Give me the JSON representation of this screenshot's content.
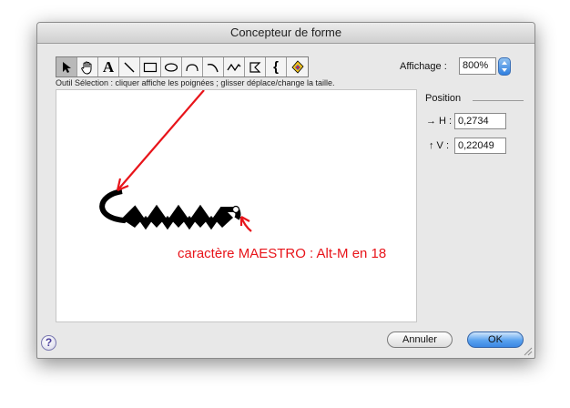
{
  "window": {
    "title": "Concepteur de forme"
  },
  "toolbar": {
    "tools": [
      {
        "icon": "arrow-select-icon",
        "selected": true
      },
      {
        "icon": "hand-icon"
      },
      {
        "icon": "text-a-icon",
        "glyph": "A"
      },
      {
        "icon": "line-icon"
      },
      {
        "icon": "rectangle-icon"
      },
      {
        "icon": "ellipse-icon"
      },
      {
        "icon": "arc-icon"
      },
      {
        "icon": "curve-icon"
      },
      {
        "icon": "wave-icon"
      },
      {
        "icon": "polygon-icon"
      },
      {
        "icon": "brace-icon",
        "glyph": "{"
      },
      {
        "icon": "fill-color-icon"
      }
    ],
    "hint": "Outil Sélection : cliquer affiche les poignées ; glisser déplace/change la taille."
  },
  "zoom": {
    "label": "Affichage :",
    "value": "800%"
  },
  "position": {
    "title": "Position",
    "h_label": "→ H :",
    "h_value": "0,2734",
    "v_label": "↑ V :",
    "v_value": "0,22049"
  },
  "canvas": {
    "annotation": "caractère MAESTRO : Alt-M en 18",
    "annotation_color": "#e8141a",
    "shape_color": "#000000"
  },
  "buttons": {
    "cancel": "Annuler",
    "ok": "OK",
    "help": "?"
  },
  "colors": {
    "accent": "#3b87e3"
  }
}
